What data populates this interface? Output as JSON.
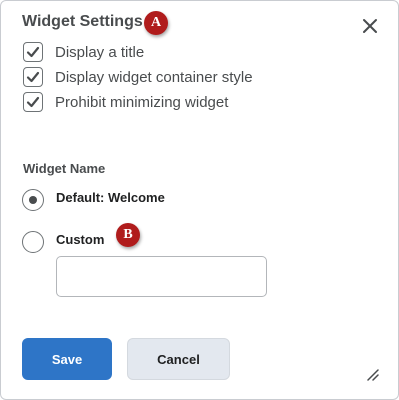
{
  "dialog": {
    "title": "Widget Settings",
    "close_icon": "close-icon",
    "markers": {
      "a": "A",
      "b": "B"
    },
    "marker_color": "#b01c1c"
  },
  "options": [
    {
      "label": "Display a title",
      "checked": true
    },
    {
      "label": "Display widget container style",
      "checked": true
    },
    {
      "label": "Prohibit minimizing widget",
      "checked": true
    }
  ],
  "widget_name": {
    "section_label": "Widget Name",
    "default_label": "Default: Welcome",
    "custom_label": "Custom",
    "selected": "default",
    "custom_value": ""
  },
  "buttons": {
    "save_label": "Save",
    "cancel_label": "Cancel",
    "save_color": "#2e75c7",
    "cancel_color": "#e3e8ef"
  },
  "icons": {
    "resize": "resize-handle-icon",
    "check": "checkmark-icon"
  }
}
